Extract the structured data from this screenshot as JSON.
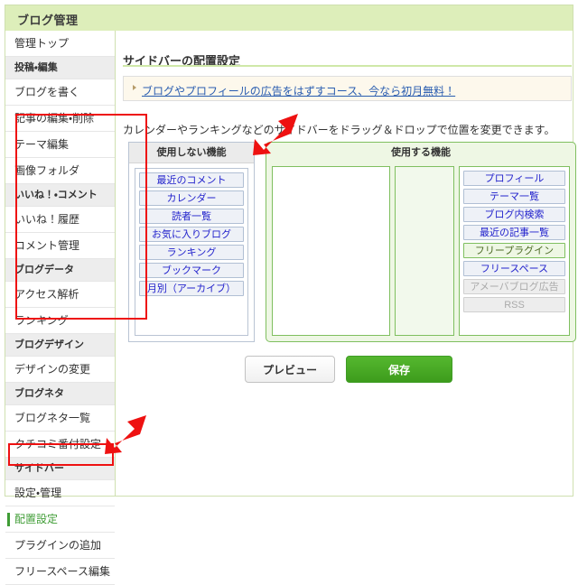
{
  "header": {
    "title": "ブログ管理",
    "background": "#ddeeba"
  },
  "sidebar": {
    "items": [
      {
        "label": "管理トップ",
        "type": "link",
        "current": false
      },
      {
        "label": "投稿・編集",
        "type": "section",
        "current": false
      },
      {
        "label": "ブログを書く",
        "type": "link",
        "current": false
      },
      {
        "label": "記事の編集・削除",
        "type": "link",
        "current": false
      },
      {
        "label": "テーマ編集",
        "type": "link",
        "current": false
      },
      {
        "label": "画像フォルダ",
        "type": "link",
        "current": false
      },
      {
        "label": "いいね！・コメント",
        "type": "section",
        "current": false
      },
      {
        "label": "いいね！履歴",
        "type": "link",
        "current": false
      },
      {
        "label": "コメント管理",
        "type": "link",
        "current": false
      },
      {
        "label": "ブログデータ",
        "type": "section",
        "current": false
      },
      {
        "label": "アクセス解析",
        "type": "link",
        "current": false
      },
      {
        "label": "ランキング",
        "type": "link",
        "current": false
      },
      {
        "label": "ブログデザイン",
        "type": "section",
        "current": false
      },
      {
        "label": "デザインの変更",
        "type": "link",
        "current": false
      },
      {
        "label": "ブログネタ",
        "type": "section",
        "current": false
      },
      {
        "label": "ブログネタ一覧",
        "type": "link",
        "current": false
      },
      {
        "label": "クチコミ番付設定",
        "type": "link",
        "current": false
      },
      {
        "label": "サイドバー",
        "type": "section",
        "current": false
      },
      {
        "label": "設定・管理",
        "type": "link",
        "current": false
      },
      {
        "label": "配置設定",
        "type": "link",
        "current": true
      },
      {
        "label": "プラグインの追加",
        "type": "link",
        "current": false
      },
      {
        "label": "フリースペース編集",
        "type": "link",
        "current": false
      }
    ],
    "current_color": "#3f9c35"
  },
  "main": {
    "page_title": "サイドバーの配置設定",
    "promo": {
      "text": "ブログやプロフィールの広告をはずすコース、今なら初月無料！",
      "link_color": "#2a5db0",
      "background": "#fdf8ec"
    },
    "instruction": "カレンダーやランキングなどのサイドバーをドラッグ＆ドロップで位置を変更できます。",
    "unused_panel": {
      "header": "使用しない機能",
      "items": [
        {
          "label": "最近のコメント",
          "state": "normal"
        },
        {
          "label": "カレンダー",
          "state": "normal"
        },
        {
          "label": "読者一覧",
          "state": "normal"
        },
        {
          "label": "お気に入りブログ",
          "state": "normal"
        },
        {
          "label": "ランキング",
          "state": "normal"
        },
        {
          "label": "ブックマーク",
          "state": "normal"
        },
        {
          "label": "月別（アーカイブ）",
          "state": "normal"
        }
      ]
    },
    "used_panel": {
      "header": "使用する機能",
      "columns": [
        {
          "name": "column-left",
          "items": []
        },
        {
          "name": "column-center",
          "items": []
        },
        {
          "name": "column-right",
          "items": [
            {
              "label": "プロフィール",
              "state": "normal"
            },
            {
              "label": "テーマ一覧",
              "state": "normal"
            },
            {
              "label": "ブログ内検索",
              "state": "normal"
            },
            {
              "label": "最近の記事一覧",
              "state": "normal"
            },
            {
              "label": "フリープラグイン",
              "state": "highlight"
            },
            {
              "label": "フリースペース",
              "state": "normal"
            },
            {
              "label": "アメーバブログ広告",
              "state": "disabled"
            },
            {
              "label": "RSS",
              "state": "disabled"
            }
          ]
        }
      ]
    },
    "actions": {
      "preview_label": "プレビュー",
      "save_label": "保存",
      "save_color": "#47ab26"
    }
  },
  "annotations": {
    "color": "#ee1111",
    "arrows": [
      {
        "name": "arrow-to-unused-panel",
        "direction": "down-left"
      },
      {
        "name": "arrow-to-nav-item",
        "direction": "down-left"
      }
    ],
    "boxes": [
      {
        "name": "unused-panel-highlight"
      },
      {
        "name": "nav-item-highlight"
      }
    ]
  }
}
